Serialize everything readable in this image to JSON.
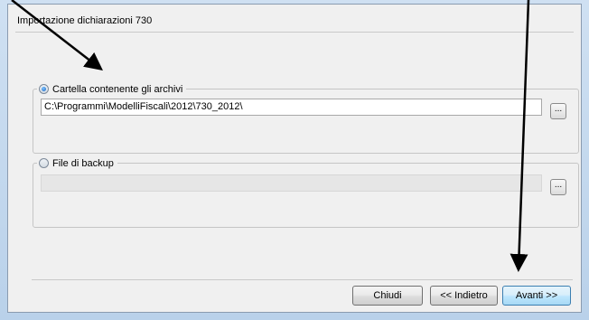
{
  "window": {
    "title": "Importazione dichiarazioni 730"
  },
  "archives_group": {
    "label": "Cartella contenente gli archivi",
    "selected": true,
    "path_value": "C:\\Programmi\\ModelliFiscali\\2012\\730_2012\\",
    "browse_label": "..."
  },
  "backup_group": {
    "label": "File di backup",
    "selected": false,
    "path_value": "",
    "browse_label": "..."
  },
  "buttons": {
    "close": "Chiudi",
    "back": "<< Indietro",
    "next": "Avanti >>"
  },
  "annotation_color": "#000000"
}
